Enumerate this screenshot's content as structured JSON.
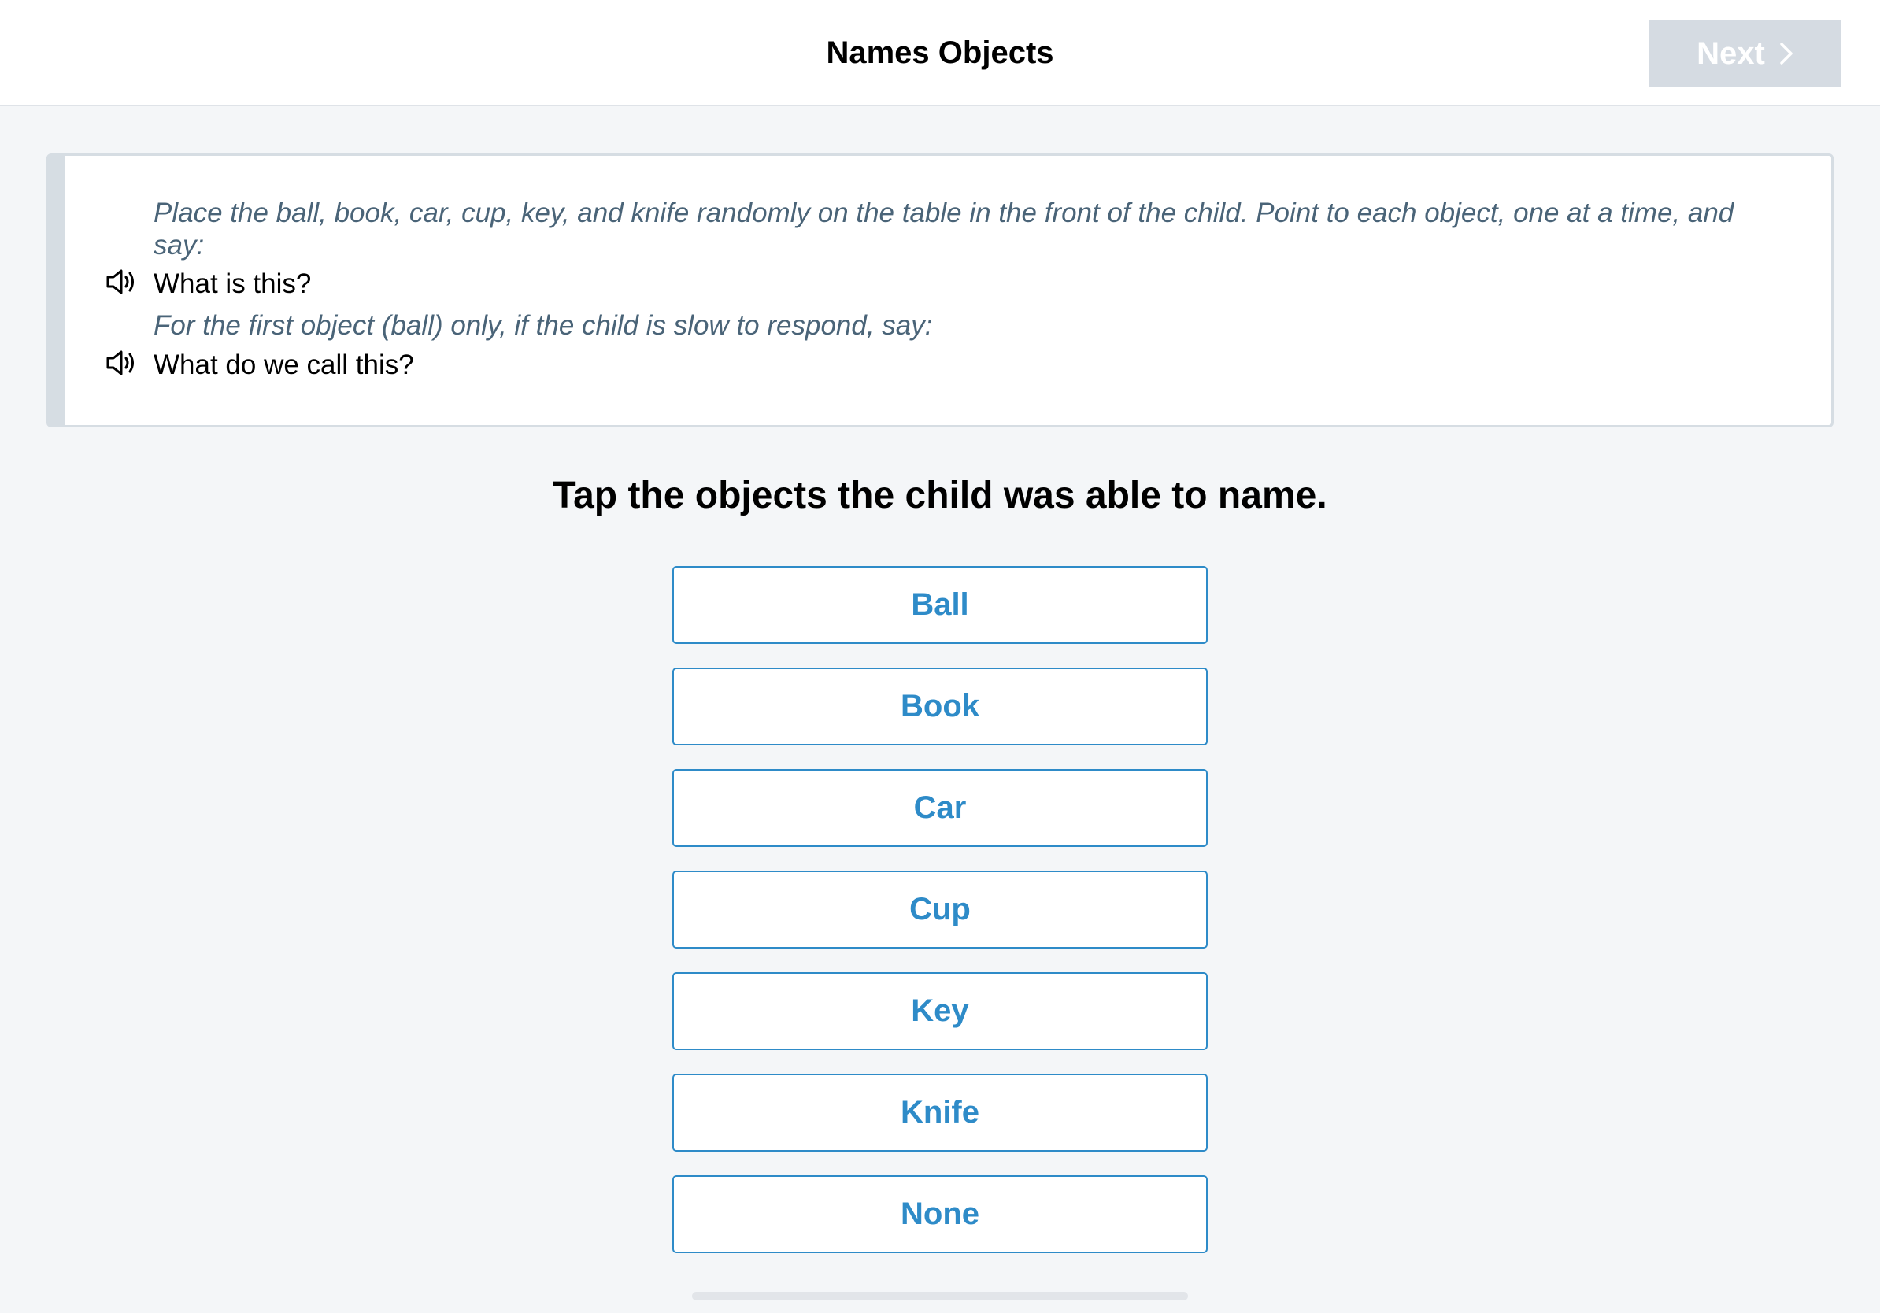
{
  "header": {
    "title": "Names Objects",
    "next_label": "Next"
  },
  "instructions": {
    "note_1": "Place the ball, book, car, cup, key, and knife randomly on the table in the front of the child. Point to each object, one at a time, and say:",
    "prompt_1": "What is this?",
    "note_2": "For the first object (ball) only, if the child is slow to respond, say:",
    "prompt_2": "What do we call this?"
  },
  "question": "Tap the objects the child was able to name.",
  "options": [
    "Ball",
    "Book",
    "Car",
    "Cup",
    "Key",
    "Knife",
    "None"
  ],
  "colors": {
    "accent": "#2e8bc8",
    "next_disabled": "#d5dbe2",
    "note_text": "#4a6478",
    "background": "#f4f6f8"
  }
}
